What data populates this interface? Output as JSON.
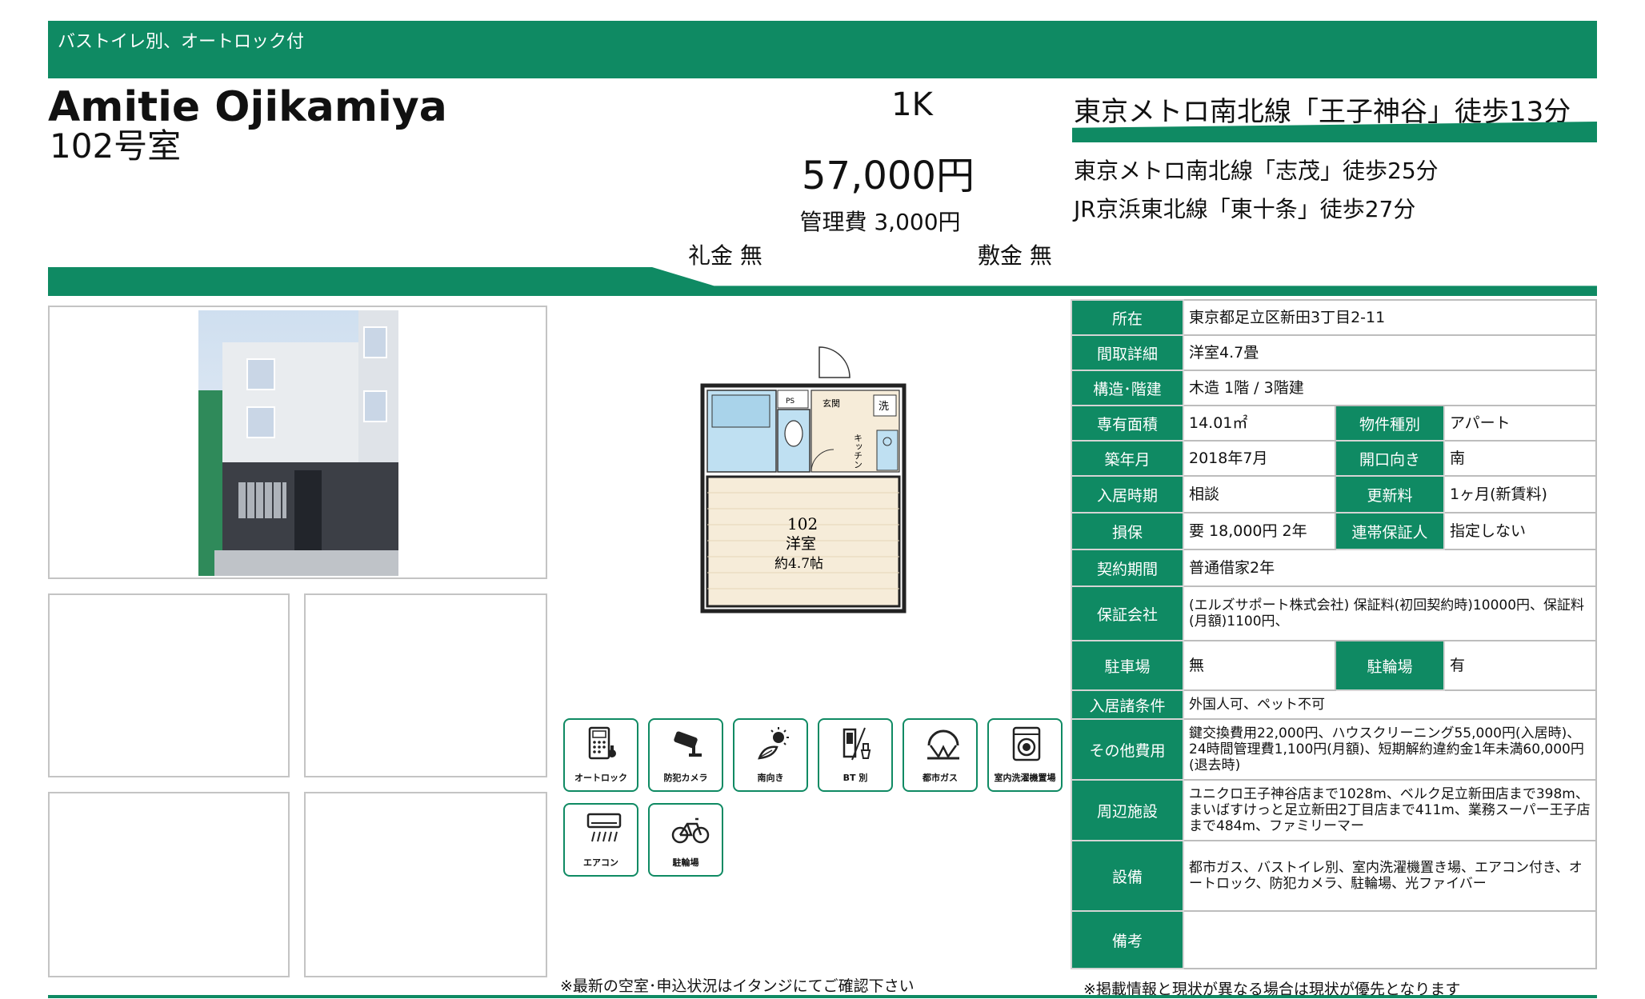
{
  "banner": {
    "text": "バストイレ別、オートロック付"
  },
  "property": {
    "name": "Amitie Ojikamiya",
    "room": "102号室",
    "layout": "1K",
    "rent": "57,000円",
    "management_fee": "管理費 3,000円",
    "key_money": "礼金 無",
    "deposit": "敷金 無"
  },
  "stations": [
    "東京メトロ南北線「王子神谷」徒歩13分",
    "東京メトロ南北線「志茂」徒歩25分",
    "JR京浜東北線「東十条」徒歩27分"
  ],
  "floorplan": {
    "room_no": "102",
    "room_type": "洋室",
    "room_size": "約4.7帖",
    "kitchen": "キッチン",
    "entrance": "玄関",
    "washer": "洗",
    "ps": "PS"
  },
  "features": [
    {
      "label": "オートロック",
      "icon": "auto-lock-icon"
    },
    {
      "label": "防犯カメラ",
      "icon": "security-camera-icon"
    },
    {
      "label": "南向き",
      "icon": "south-facing-icon"
    },
    {
      "label": "BT 別",
      "icon": "bath-toilet-separate-icon"
    },
    {
      "label": "都市ガス",
      "icon": "city-gas-icon"
    },
    {
      "label": "室内洗濯機置場",
      "icon": "washing-machine-icon"
    },
    {
      "label": "エアコン",
      "icon": "air-conditioner-icon"
    },
    {
      "label": "駐輪場",
      "icon": "bicycle-parking-icon"
    }
  ],
  "table": {
    "location_label": "所在",
    "location": "東京都足立区新田3丁目2-11",
    "layout_detail_label": "間取詳細",
    "layout_detail": "洋室4.7畳",
    "structure_label": "構造･階建",
    "structure": "木造 1階 / 3階建",
    "area_label": "専有面積",
    "area": "14.01㎡",
    "type_label": "物件種別",
    "type": "アパート",
    "built_label": "築年月",
    "built": "2018年7月",
    "facing_label": "開口向き",
    "facing": "南",
    "move_in_label": "入居時期",
    "move_in": "相談",
    "renewal_label": "更新料",
    "renewal": "1ヶ月(新賃料)",
    "deduction_label": "損保",
    "deduction": "要 18,000円 2年",
    "guarantor_label": "連帯保証人",
    "guarantor": "指定しない",
    "contract_label": "契約期間",
    "contract": "普通借家2年",
    "guarantee_co_label": "保証会社",
    "guarantee_co": "(エルズサポート株式会社) 保証料(初回契約時)10000円、保証料(月額)1100円、",
    "parking_label": "駐車場",
    "parking": "無",
    "bike_label": "駐輪場",
    "bike": "有",
    "conditions_label": "入居諸条件",
    "conditions": "外国人可、ペット不可",
    "other_fees_label": "その他費用",
    "other_fees": "鍵交換費用22,000円、ハウスクリーニング55,000円(入居時)、24時間管理費1,100円(月額)、短期解約違約金1年未満60,000円(退去時)",
    "nearby_label": "周辺施設",
    "nearby": "ユニクロ王子神谷店まで1028m、ベルク足立新田店まで398m、まいばすけっと足立新田2丁目店まで411m、業務スーパー王子店まで484m、ファミリーマー",
    "facilities_label": "設備",
    "facilities": "都市ガス、バストイレ別、室内洗濯機置き場、エアコン付き、オートロック、防犯カメラ、駐輪場、光ファイバー",
    "remarks_label": "備考",
    "remarks": ""
  },
  "notes": {
    "left": "※最新の空室･申込状況はイタンジにてご確認下さい",
    "right": "※掲載情報と現状が異なる場合は現状が優先となります"
  },
  "colors": {
    "brand": "#0f8a63"
  }
}
